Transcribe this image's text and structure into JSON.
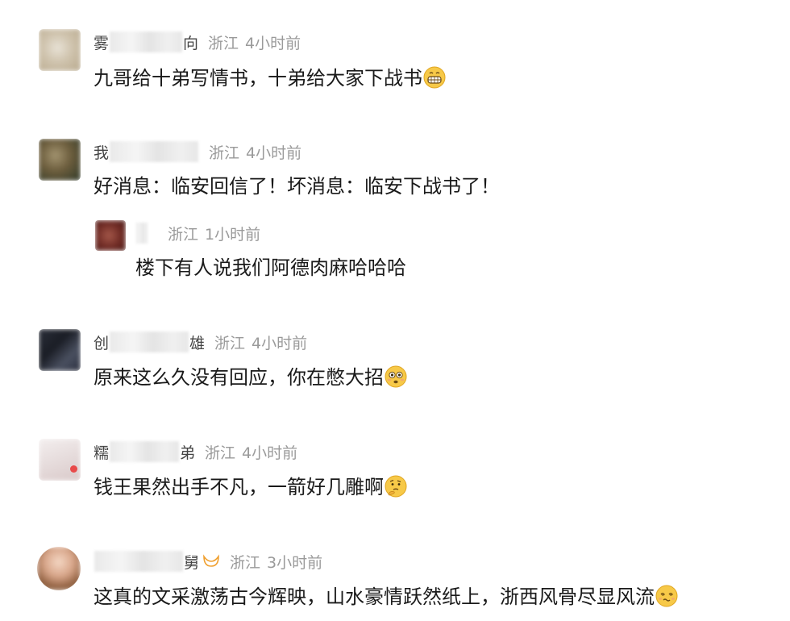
{
  "comments": [
    {
      "name_first": "雾",
      "name_last": "向",
      "location": "浙江",
      "time": "4小时前",
      "text": "九哥给十弟写情书，十弟给大家下战书",
      "emoji": "grin-emoji"
    },
    {
      "name_first": "我",
      "name_last": "",
      "location": "浙江",
      "time": "4小时前",
      "text": "好消息：临安回信了！坏消息：临安下战书了！",
      "reply": {
        "name_first": "",
        "location": "浙江",
        "time": "1小时前",
        "text": "楼下有人说我们阿德肉麻哈哈哈"
      }
    },
    {
      "name_first": "创",
      "name_last": "雄",
      "location": "浙江",
      "time": "4小时前",
      "text": "原来这么久没有回应，你在憋大招",
      "emoji": "flushed-emoji"
    },
    {
      "name_first": "糯",
      "name_last": "弟",
      "location": "浙江",
      "time": "4小时前",
      "text": "钱王果然出手不凡，一箭好几雕啊",
      "emoji": "thinking-emoji"
    },
    {
      "name_first": "",
      "name_last": "舅",
      "location": "浙江",
      "time": "3小时前",
      "text": "这真的文采激荡古今辉映，山水豪情跃然纸上，浙西风骨尽显风流",
      "emoji": "dizzy-emoji"
    }
  ]
}
